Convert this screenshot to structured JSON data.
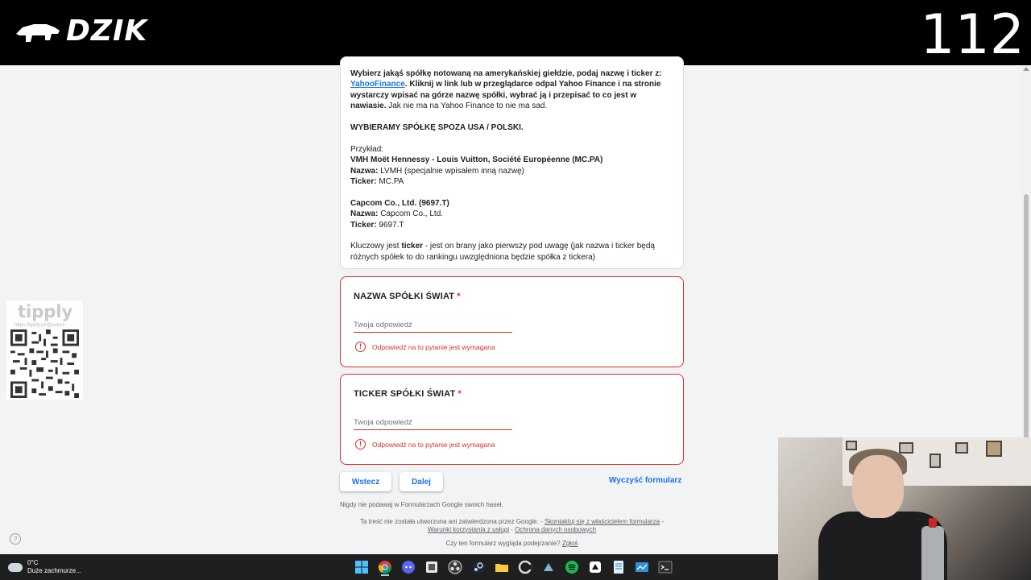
{
  "overlay": {
    "brand": "DZIK",
    "counter": "112",
    "tippy": {
      "name": "tipply",
      "url": "https://tipply.pl/@potrex"
    }
  },
  "form": {
    "description": {
      "p1_bold_a": "Wybierz jakąś spółkę notowaną na amerykańskiej giełdzie, podaj nazwę i ticker z: ",
      "p1_link": "YahooFinance",
      "p1_bold_b": ". Kliknij w link lub w przeglądarce odpal Yahoo Finance i na stronie wystarczy wpisać na górze nazwę spółki, wybrać ją i przepisać to co jest w nawiasie.",
      "p1_plain": " Jak nie ma na Yahoo Finance to nie ma sad.",
      "p2": "WYBIERAMY SPÓŁKĘ SPOZA USA / POLSKI.",
      "example_label": "Przykład:",
      "ex1_title": "VMH Moët Hennessy - Louis Vuitton, Société Européenne (MC.PA)",
      "ex1_name_label": "Nazwa:",
      "ex1_name": " LVMH (specjalnie wpisałem inną nazwę)",
      "ex1_ticker_label": "Ticker:",
      "ex1_ticker": " MC.PA",
      "ex2_title": "Capcom Co., Ltd. (9697.T)",
      "ex2_name_label": "Nazwa:",
      "ex2_name": " Capcom Co., Ltd.",
      "ex2_ticker_label": "Ticker:",
      "ex2_ticker": " 9697.T",
      "key_a": "Kluczowy jest ",
      "key_bold": "ticker",
      "key_b": " - jest on brany jako pierwszy pod uwagę (jak nazwa i ticker będą różnych spółek to do rankingu uwzględniona będzie spółka z tickera)"
    },
    "questions": [
      {
        "title": "NAZWA SPÓŁKI ŚWIAT",
        "required": "*",
        "placeholder": "Twoja odpowiedź",
        "value": "",
        "error": "Odpowiedź na to pytanie jest wymagana"
      },
      {
        "title": "TICKER SPÓŁKI ŚWIAT",
        "required": "*",
        "placeholder": "Twoja odpowiedź",
        "value": "",
        "error": "Odpowiedź na to pytanie jest wymagana"
      }
    ],
    "buttons": {
      "back": "Wstecz",
      "next": "Dalej",
      "clear": "Wyczyść formularz"
    },
    "never_text": "Nigdy nie podawaj w Formularzach Google swoich haseł.",
    "footer": {
      "line1": "Ta treść nie została utworzona ani zatwierdzona przez Google. - ",
      "contact": "Skontaktuj się z właścicielem formularza",
      "sep1": " -",
      "terms": "Warunki korzystania z usługi",
      "sep2": " - ",
      "privacy": "Ochrona danych osobowych",
      "line3": "Czy ten formularz wygląda podejrzanie? ",
      "report": "Zgłoś"
    }
  },
  "taskbar": {
    "temperature": "0°C",
    "weather": "Duże zachmurze...",
    "icons": [
      "windows-start-icon",
      "chrome-icon",
      "discord-icon",
      "app-icon",
      "obs-icon",
      "steam-icon",
      "explorer-icon",
      "ccleaner-icon",
      "app-icon-2",
      "spotify-icon",
      "app-icon-3",
      "notepad-icon",
      "app-icon-4",
      "terminal-icon"
    ]
  },
  "colors": {
    "error": "#d93025",
    "link": "#1a73e8",
    "background": "#f1f3f4"
  }
}
